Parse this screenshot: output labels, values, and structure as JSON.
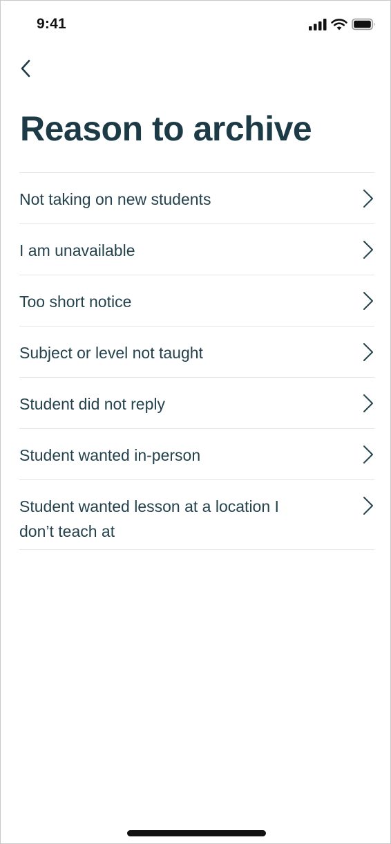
{
  "status_bar": {
    "time": "9:41",
    "icons": [
      "signal-icon",
      "wifi-icon",
      "battery-icon"
    ]
  },
  "header": {
    "back_icon": "chevron-left-icon",
    "title": "Reason to archive"
  },
  "reasons": [
    {
      "label": "Not taking on new students",
      "icon": "chevron-right-icon"
    },
    {
      "label": "I am unavailable",
      "icon": "chevron-right-icon"
    },
    {
      "label": "Too short notice",
      "icon": "chevron-right-icon"
    },
    {
      "label": "Subject or level not taught",
      "icon": "chevron-right-icon"
    },
    {
      "label": "Student did not reply",
      "icon": "chevron-right-icon"
    },
    {
      "label": "Student wanted in-person",
      "icon": "chevron-right-icon"
    },
    {
      "label": "Student wanted lesson at a location I don’t teach at",
      "icon": "chevron-right-icon"
    }
  ],
  "colors": {
    "text_primary": "#1d3b46",
    "divider": "#e3e6e8",
    "background": "#ffffff"
  }
}
